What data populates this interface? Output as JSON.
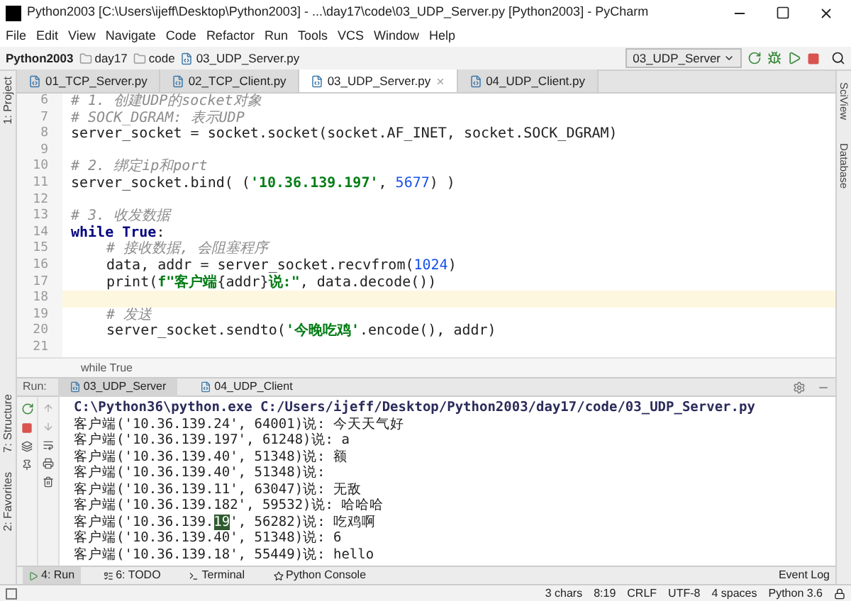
{
  "window": {
    "title": "Python2003 [C:\\Users\\ijeff\\Desktop\\Python2003] - ...\\day17\\code\\03_UDP_Server.py [Python2003] - PyCharm"
  },
  "menu": [
    "File",
    "Edit",
    "View",
    "Navigate",
    "Code",
    "Refactor",
    "Run",
    "Tools",
    "VCS",
    "Window",
    "Help"
  ],
  "breadcrumbs": [
    "Python2003",
    "day17",
    "code",
    "03_UDP_Server.py"
  ],
  "run_config": "03_UDP_Server",
  "left_tools": [
    "1: Project",
    "7: Structure",
    "2: Favorites"
  ],
  "right_tools": [
    "SciView",
    "Database"
  ],
  "tabs": [
    {
      "label": "01_TCP_Server.py",
      "selected": false
    },
    {
      "label": "02_TCP_Client.py",
      "selected": false
    },
    {
      "label": "03_UDP_Server.py",
      "selected": true
    },
    {
      "label": "04_UDP_Client.py",
      "selected": false
    }
  ],
  "code": [
    {
      "n": "6",
      "current": false,
      "indented": false,
      "tokens": [
        {
          "kind": "comment",
          "text": "# 1. 创建UDP的socket对象"
        }
      ]
    },
    {
      "n": "7",
      "current": false,
      "indented": false,
      "tokens": [
        {
          "kind": "comment",
          "text": "# SOCK_DGRAM: 表示UDP"
        }
      ]
    },
    {
      "n": "8",
      "current": false,
      "indented": false,
      "tokens": [
        {
          "kind": "plain",
          "text": "server_socket = socket.socket(socket.AF_INET, socket.SOCK_DGRAM)"
        }
      ]
    },
    {
      "n": "9",
      "current": false
    },
    {
      "n": "10",
      "current": false,
      "indented": false,
      "tokens": [
        {
          "kind": "comment",
          "text": "# 2. 绑定ip和port"
        }
      ]
    },
    {
      "n": "11",
      "current": false,
      "indented": false,
      "tokens": [
        {
          "kind": "plain",
          "text": "server_socket.bind( ("
        },
        {
          "kind": "string",
          "text": "'10.36.139.197'"
        },
        {
          "kind": "plain",
          "text": ", "
        },
        {
          "kind": "number",
          "text": "5677"
        },
        {
          "kind": "plain",
          "text": ") )"
        }
      ]
    },
    {
      "n": "12",
      "current": false
    },
    {
      "n": "13",
      "current": false,
      "indented": false,
      "tokens": [
        {
          "kind": "comment",
          "text": "# 3. 收发数据"
        }
      ]
    },
    {
      "n": "14",
      "current": false,
      "indented": false,
      "tokens": [
        {
          "kind": "keyword",
          "text": "while True"
        },
        {
          "kind": "plain",
          "text": ":"
        }
      ]
    },
    {
      "n": "15",
      "current": false,
      "indented": true,
      "tokens": [
        {
          "kind": "comment",
          "text": "# 接收数据, 会阻塞程序"
        }
      ]
    },
    {
      "n": "16",
      "current": false,
      "indented": true,
      "tokens": [
        {
          "kind": "plain",
          "text": "data, addr = server_socket.recvfrom("
        },
        {
          "kind": "number",
          "text": "1024"
        },
        {
          "kind": "plain",
          "text": ")"
        }
      ]
    },
    {
      "n": "17",
      "current": false,
      "indented": true,
      "tokens": [
        {
          "kind": "plain",
          "text": "print("
        },
        {
          "kind": "string",
          "text": "f\"客户端"
        },
        {
          "kind": "plain",
          "text": "{addr}"
        },
        {
          "kind": "string",
          "text": "说:\""
        },
        {
          "kind": "plain",
          "text": ", data.decode())"
        }
      ]
    },
    {
      "n": "18",
      "current": true
    },
    {
      "n": "19",
      "current": false,
      "indented": true,
      "tokens": [
        {
          "kind": "comment",
          "text": "# 发送"
        }
      ]
    },
    {
      "n": "20",
      "current": false,
      "indented": true,
      "tokens": [
        {
          "kind": "plain",
          "text": "server_socket.sendto("
        },
        {
          "kind": "string",
          "text": "'今晚吃鸡'"
        },
        {
          "kind": "plain",
          "text": ".encode(), addr)"
        }
      ]
    },
    {
      "n": "21",
      "current": false
    }
  ],
  "editor_breadcrumb": "while True",
  "run_label": "Run:",
  "run_tabs": [
    {
      "label": "03_UDP_Server",
      "selected": true
    },
    {
      "label": "04_UDP_Client",
      "selected": false
    }
  ],
  "console": [
    [
      {
        "text": "C:\\Python36\\python.exe C:/Users/ijeff/Desktop/Python2003/day17/code/03_UDP_Server.py",
        "selected": false
      }
    ],
    [
      {
        "text": "客户端('10.36.139.24', 64001)说: 今天天气好",
        "selected": false
      }
    ],
    [
      {
        "text": "客户端('10.36.139.197', 61248)说: a",
        "selected": false
      }
    ],
    [
      {
        "text": "客户端('10.36.139.40', 51348)说: 额",
        "selected": false
      }
    ],
    [
      {
        "text": "客户端('10.36.139.40', 51348)说:",
        "selected": false
      }
    ],
    [
      {
        "text": "客户端('10.36.139.11', 63047)说: 无敌",
        "selected": false
      }
    ],
    [
      {
        "text": "客户端('10.36.139.182', 59532)说: 哈哈哈",
        "selected": false
      }
    ],
    [
      {
        "text": "客户端('10.36.139.",
        "selected": false
      },
      {
        "text": "19",
        "selected": true
      },
      {
        "text": "', 56282)说: 吃鸡啊",
        "selected": false
      }
    ],
    [
      {
        "text": "客户端('10.36.139.40', 51348)说: 6",
        "selected": false
      }
    ],
    [
      {
        "text": "客户端('10.36.139.18', 55449)说: hello",
        "selected": false
      }
    ]
  ],
  "bottom_tabs": [
    {
      "label": "4: Run",
      "selected": true
    },
    {
      "label": "6: TODO",
      "selected": false
    },
    {
      "label": "Terminal",
      "selected": false
    },
    {
      "label": "Python Console",
      "selected": false
    }
  ],
  "event_log": "Event Log",
  "status": [
    "3 chars",
    "8:19",
    "CRLF",
    "UTF-8",
    "4 spaces",
    "Python 3.6"
  ]
}
